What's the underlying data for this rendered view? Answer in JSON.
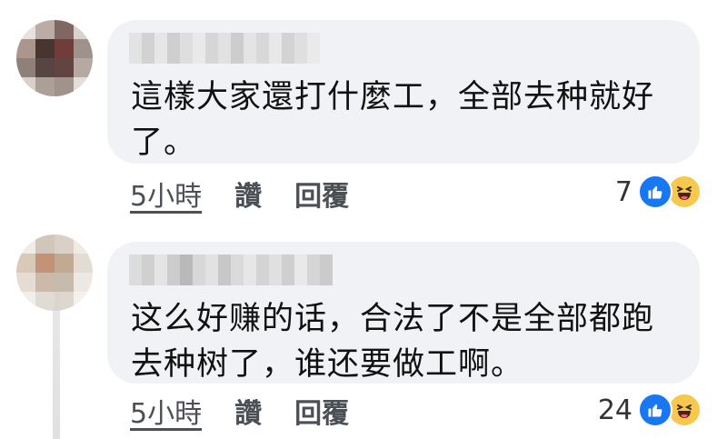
{
  "comments": [
    {
      "text": "這樣大家還打什麼工，全部去种就好了。",
      "time": "5小時",
      "like_label": "讚",
      "reply_label": "回覆",
      "reaction_count": "7"
    },
    {
      "text": "这么好赚的话，合法了不是全部都跑去种树了，谁还要做工啊。",
      "time": "5小時",
      "like_label": "讚",
      "reply_label": "回覆",
      "reaction_count": "24"
    }
  ],
  "reaction_icons": [
    "like-icon",
    "haha-icon"
  ],
  "colors": {
    "bubble": "#f0f2f5",
    "like": "#1877f2",
    "haha": "#f7c74e",
    "meta_text": "#4b4f56"
  }
}
